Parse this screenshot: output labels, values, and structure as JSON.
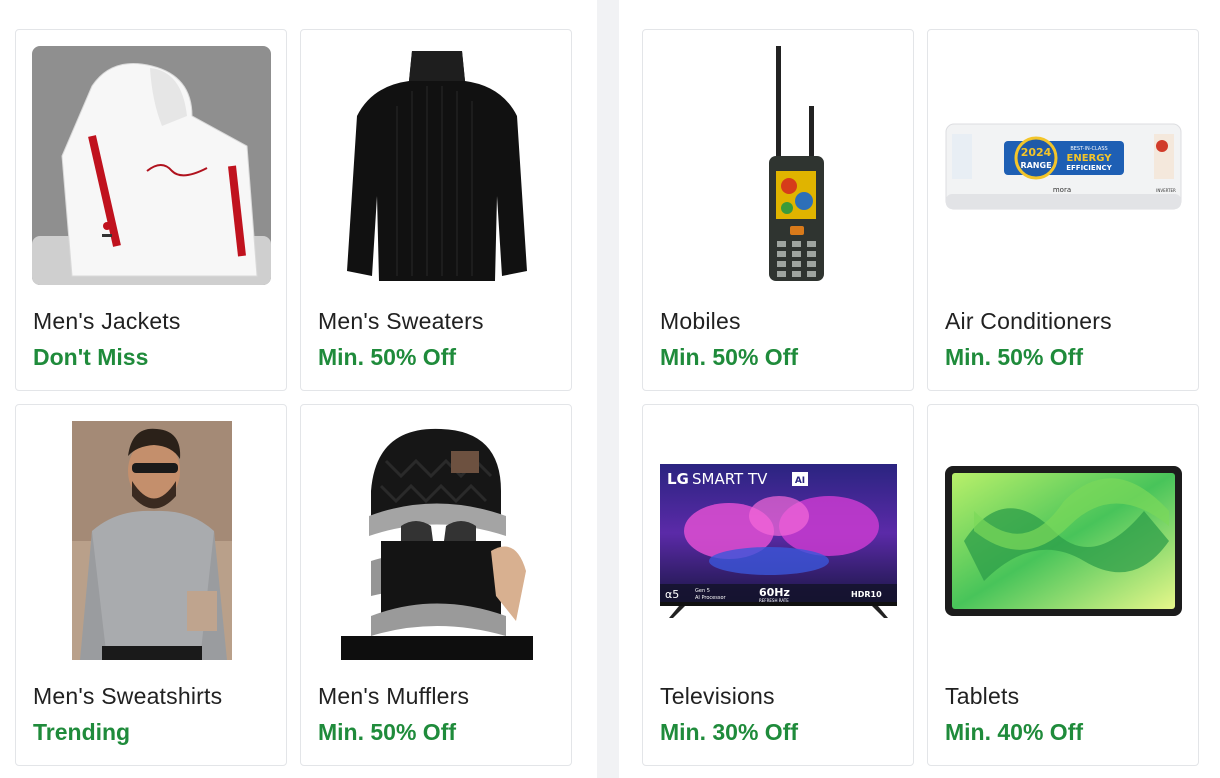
{
  "left_section": {
    "cards": [
      {
        "title": "Men's Jackets",
        "subtitle": "Don't Miss",
        "image": "white-jacket"
      },
      {
        "title": "Men's Sweaters",
        "subtitle": "Min. 50% Off",
        "image": "black-turtleneck"
      },
      {
        "title": "Men's Sweatshirts",
        "subtitle": "Trending",
        "image": "grey-sweatshirt-model"
      },
      {
        "title": "Men's Mufflers",
        "subtitle": "Min. 50% Off",
        "image": "black-muffler-cap"
      }
    ]
  },
  "right_section": {
    "cards": [
      {
        "title": "Mobiles",
        "subtitle": "Min. 50% Off",
        "image": "rugged-feature-phone"
      },
      {
        "title": "Air Conditioners",
        "subtitle": "Min. 50% Off",
        "image": "split-ac",
        "badge": {
          "year": "2024",
          "range": "RANGE",
          "line1": "BEST-IN-CLASS",
          "line2": "ENERGY",
          "line3": "EFFICIENCY",
          "brand": "mora",
          "type": "INVERTER"
        }
      },
      {
        "title": "Televisions",
        "subtitle": "Min. 30% Off",
        "image": "lg-smart-tv",
        "tv": {
          "brand": "LG",
          "heading": "SMART TV",
          "ai": "AI",
          "chip": "α5",
          "gen": "Gen 5",
          "proc": "AI Processor",
          "hz": "60Hz",
          "rate": "REFRESH RATE",
          "hdr": "HDR10"
        }
      },
      {
        "title": "Tablets",
        "subtitle": "Min. 40% Off",
        "image": "tablet-green-wallpaper"
      }
    ]
  },
  "colors": {
    "accent_green": "#1f8b3b",
    "text": "#212121",
    "divider": "#f1f2f4",
    "border": "#e3e5e8"
  }
}
